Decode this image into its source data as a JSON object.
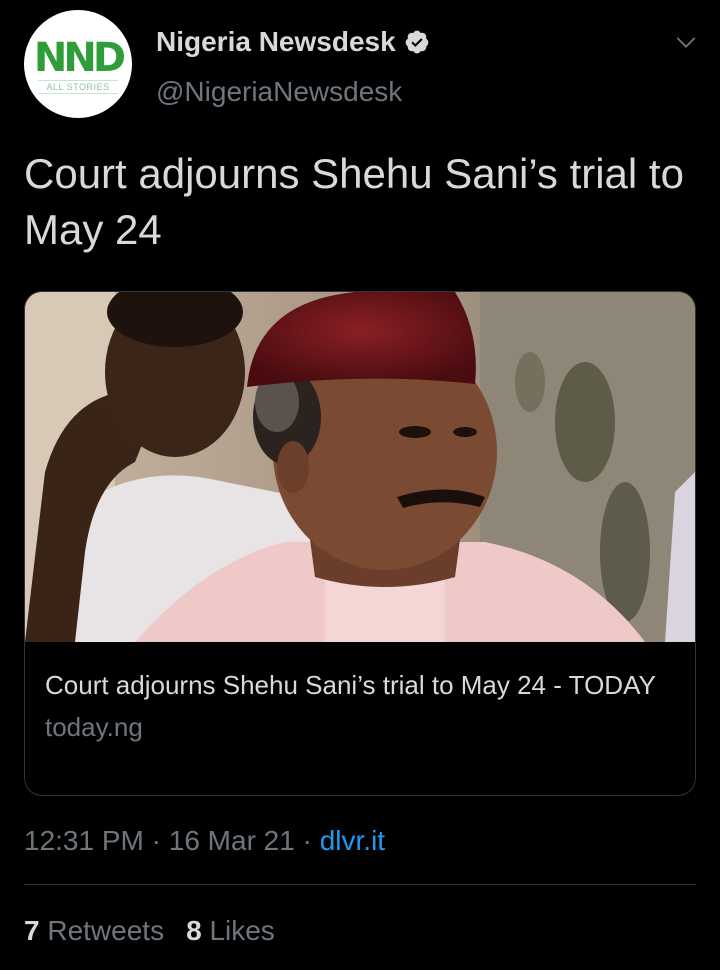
{
  "author": {
    "display_name": "Nigeria Newsdesk",
    "handle": "@NigeriaNewsdesk",
    "avatar_logo": "NND",
    "avatar_subtitle": "ALL STORIES",
    "verified_icon": "verified-badge-icon",
    "menu_icon": "chevron-down-icon"
  },
  "tweet": {
    "text": "Court adjourns Shehu Sani’s trial to May 24"
  },
  "card": {
    "image": "photo-two-men-one-in-red-cap",
    "title": "Court adjourns Shehu Sani’s trial to May 24 - TODAY",
    "domain": "today.ng"
  },
  "meta": {
    "time": "12:31 PM",
    "separator": " · ",
    "date": "16 Mar 21",
    "source": "dlvr.it"
  },
  "stats": {
    "retweets_count": "7",
    "retweets_label": "Retweets",
    "likes_count": "8",
    "likes_label": "Likes"
  },
  "colors": {
    "background": "#000000",
    "text_primary": "#d9d9d9",
    "text_secondary": "#6e767d",
    "link": "#1d9bf0",
    "border": "#2f3336",
    "logo_green": "#2e9d3a"
  }
}
